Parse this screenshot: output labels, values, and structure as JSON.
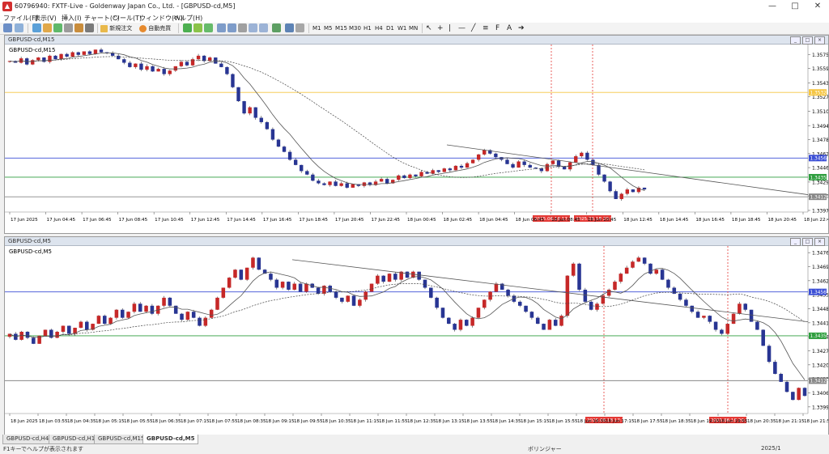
{
  "window": {
    "title": "60796940: FXTF-Live - Goldenway Japan Co., Ltd. - [GBPUSD-cd,M5]",
    "controls": [
      "—",
      "□",
      "✕"
    ]
  },
  "menu": [
    "ファイル(F)",
    "表示(V)",
    "挿入(I)",
    "チャート(C)",
    "ツール(T)",
    "ウィンドウ(W)",
    "ヘルプ(H)"
  ],
  "toolbar": {
    "new_order": "新規注文",
    "auto_trade": "自動売買",
    "timeframes": [
      "M1",
      "M5",
      "M15",
      "M30",
      "H1",
      "H4",
      "D1",
      "W1",
      "MN"
    ]
  },
  "top_chart": {
    "window_title": "GBPUSD-cd,M15",
    "label": "GBPUSD-cd,M15",
    "price_ticks": [
      "1.35755",
      "1.35595",
      "1.35430",
      "1.35270",
      "1.35105",
      "1.34940",
      "1.34780",
      "1.34620",
      "1.34460",
      "1.34295",
      "1.34135",
      "1.33970"
    ],
    "price_badges": [
      {
        "text": "1.35320",
        "color": "#f5c542",
        "y": 1.3532
      },
      {
        "text": "1.34569",
        "color": "#3b4fd6",
        "y": 1.34569
      },
      {
        "text": "1.34350",
        "color": "#2e9e3e",
        "y": 1.3435
      },
      {
        "text": "1.34126",
        "color": "#888888",
        "y": 1.34126
      }
    ],
    "time_ticks": [
      "17 Jun 2025",
      "17 Jun 04:45",
      "17 Jun 06:45",
      "17 Jun 08:45",
      "17 Jun 10:45",
      "17 Jun 12:45",
      "17 Jun 14:45",
      "17 Jun 16:45",
      "17 Jun 18:45",
      "17 Jun 20:45",
      "17 Jun 22:45",
      "18 Jun 00:45",
      "18 Jun 02:45",
      "18 Jun 04:45",
      "18 Jun 06:45",
      "18 Jun 08:45",
      "18 Jun 10:45",
      "18 Jun 12:45",
      "18 Jun 14:45",
      "18 Jun 16:45",
      "18 Jun 18:45",
      "18 Jun 20:45",
      "18 Jun 22:45"
    ],
    "vline_labels": [
      "2025.06.18 17:30",
      "2025.06.18 20:30"
    ]
  },
  "bottom_chart": {
    "window_title": "GBPUSD-cd,M5",
    "label": "GBPUSD-cd,M5",
    "price_ticks": [
      "1.34765",
      "1.34695",
      "1.34625",
      "1.34555",
      "1.34485",
      "1.34415",
      "1.34345",
      "1.34275",
      "1.34205",
      "1.34135",
      "1.34065",
      "1.33995"
    ],
    "price_badges": [
      {
        "text": "1.34569",
        "color": "#3b4fd6",
        "y": 1.34569
      },
      {
        "text": "1.34350",
        "color": "#2e9e3e",
        "y": 1.3435
      },
      {
        "text": "1.34126",
        "color": "#888888",
        "y": 1.34126
      }
    ],
    "time_ticks": [
      "18 Jun 2025",
      "18 Jun 03:55",
      "18 Jun 04:35",
      "18 Jun 05:15",
      "18 Jun 05:55",
      "18 Jun 06:35",
      "18 Jun 07:15",
      "18 Jun 07:55",
      "18 Jun 08:35",
      "18 Jun 09:15",
      "18 Jun 09:55",
      "18 Jun 10:35",
      "18 Jun 11:15",
      "18 Jun 11:55",
      "18 Jun 12:35",
      "18 Jun 13:15",
      "18 Jun 13:55",
      "18 Jun 14:35",
      "18 Jun 15:15",
      "18 Jun 15:55",
      "18 Jun 16:35",
      "18 Jun 17:15",
      "18 Jun 17:55",
      "18 Jun 18:35",
      "18 Jun 19:15",
      "18 Jun 19:55",
      "18 Jun 20:35",
      "18 Jun 21:15",
      "18 Jun 21:55"
    ],
    "vline_labels": [
      "2025.06.18 17:30",
      "2025.06.18 20:30"
    ]
  },
  "tabs": [
    "GBPUSD-cd,H4",
    "GBPUSD-cd,H1",
    "GBPUSD-cd,M15",
    "GBPUSD-cd,M5"
  ],
  "active_tab": 3,
  "status": {
    "help": "F1キーでヘルプが表示されます",
    "profile": "ボリンジャー",
    "date": "2025/1"
  },
  "chart_data": [
    {
      "type": "candlestick",
      "symbol": "GBPUSD-cd",
      "timeframe": "M15",
      "ylim": [
        1.3397,
        1.3585
      ],
      "horizontal_lines": [
        1.3532,
        1.34569,
        1.3435,
        1.34126
      ],
      "closes": [
        1.3568,
        1.3566,
        1.3571,
        1.3564,
        1.3569,
        1.3572,
        1.3567,
        1.3574,
        1.357,
        1.3576,
        1.3573,
        1.3578,
        1.3575,
        1.3579,
        1.3576,
        1.3581,
        1.3578,
        1.3577,
        1.3574,
        1.357,
        1.3566,
        1.3561,
        1.3565,
        1.3558,
        1.3562,
        1.3556,
        1.3559,
        1.3553,
        1.3557,
        1.3562,
        1.3567,
        1.3563,
        1.357,
        1.3574,
        1.3568,
        1.3572,
        1.3565,
        1.3561,
        1.3553,
        1.3538,
        1.3522,
        1.3508,
        1.3515,
        1.3503,
        1.3498,
        1.349,
        1.3478,
        1.347,
        1.3464,
        1.3455,
        1.3449,
        1.3442,
        1.3438,
        1.3431,
        1.3428,
        1.3426,
        1.343,
        1.3425,
        1.3428,
        1.3423,
        1.3427,
        1.3425,
        1.3429,
        1.3426,
        1.343,
        1.3433,
        1.3428,
        1.3432,
        1.3437,
        1.3434,
        1.3438,
        1.3436,
        1.3441,
        1.3439,
        1.3443,
        1.3441,
        1.3445,
        1.3443,
        1.3448,
        1.3446,
        1.3451,
        1.3455,
        1.3461,
        1.3466,
        1.3462,
        1.3458,
        1.3455,
        1.345,
        1.3446,
        1.3453,
        1.3449,
        1.3446,
        1.3445,
        1.3442,
        1.345,
        1.3454,
        1.3447,
        1.3444,
        1.3452,
        1.3459,
        1.3463,
        1.3455,
        1.3449,
        1.3438,
        1.343,
        1.3419,
        1.341,
        1.3416,
        1.3421,
        1.3418,
        1.3423,
        1.3421
      ]
    },
    {
      "type": "candlestick",
      "symbol": "GBPUSD-cd",
      "timeframe": "M5",
      "ylim": [
        1.3397,
        1.3479
      ],
      "horizontal_lines": [
        1.34569,
        1.3435,
        1.34126
      ],
      "closes": [
        1.3436,
        1.3433,
        1.3437,
        1.3434,
        1.3431,
        1.3435,
        1.3438,
        1.3434,
        1.3437,
        1.344,
        1.3436,
        1.3439,
        1.3442,
        1.3438,
        1.3441,
        1.3445,
        1.3441,
        1.3444,
        1.3448,
        1.3444,
        1.3447,
        1.3451,
        1.3447,
        1.345,
        1.3446,
        1.345,
        1.3454,
        1.345,
        1.3446,
        1.3443,
        1.3447,
        1.3444,
        1.344,
        1.3444,
        1.3448,
        1.3454,
        1.3459,
        1.3464,
        1.3468,
        1.3463,
        1.3469,
        1.3474,
        1.3468,
        1.3466,
        1.3463,
        1.3459,
        1.3462,
        1.3458,
        1.3461,
        1.3457,
        1.3461,
        1.3459,
        1.3456,
        1.346,
        1.3457,
        1.3454,
        1.3452,
        1.3455,
        1.345,
        1.3453,
        1.3457,
        1.3461,
        1.3465,
        1.3462,
        1.3466,
        1.3463,
        1.3467,
        1.3464,
        1.3467,
        1.3463,
        1.3459,
        1.3454,
        1.3449,
        1.3444,
        1.3441,
        1.3438,
        1.3443,
        1.344,
        1.3444,
        1.3449,
        1.3453,
        1.3457,
        1.3461,
        1.3458,
        1.3455,
        1.3452,
        1.345,
        1.3447,
        1.3444,
        1.3441,
        1.3438,
        1.3443,
        1.344,
        1.3445,
        1.3465,
        1.3471,
        1.3458,
        1.3452,
        1.3448,
        1.3451,
        1.3455,
        1.3458,
        1.3462,
        1.3466,
        1.3469,
        1.3472,
        1.3474,
        1.3471,
        1.3466,
        1.3468,
        1.3463,
        1.3459,
        1.3456,
        1.3453,
        1.345,
        1.3447,
        1.3444,
        1.3445,
        1.3442,
        1.3438,
        1.3436,
        1.3441,
        1.3446,
        1.3451,
        1.3448,
        1.3442,
        1.3438,
        1.343,
        1.3422,
        1.3416,
        1.3412,
        1.3407,
        1.3403,
        1.3409,
        1.3405
      ]
    }
  ]
}
